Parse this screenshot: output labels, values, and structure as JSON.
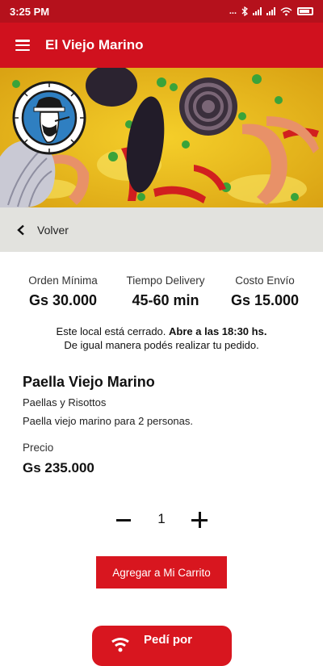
{
  "status_bar": {
    "time": "3:25 PM",
    "dots": "..."
  },
  "app_bar": {
    "title": "El Viejo Marino",
    "menu_icon": "hamburger-menu-icon"
  },
  "hero": {
    "logo_icon": "sailor-logo"
  },
  "back": {
    "label": "Volver",
    "icon": "chevron-left-icon"
  },
  "stats": [
    {
      "label": "Orden Mínima",
      "value": "Gs 30.000"
    },
    {
      "label": "Tiempo Delivery",
      "value": "45-60 min"
    },
    {
      "label": "Costo Envío",
      "value": "Gs 15.000"
    }
  ],
  "notice": {
    "closed_text": "Este local está cerrado.",
    "opens_text": "Abre a las 18:30 hs.",
    "order_anyway": "De igual manera podés realizar tu pedido."
  },
  "product": {
    "name": "Paella Viejo Marino",
    "category": "Paellas y Risottos",
    "description": "Paella viejo marino para 2 personas.",
    "price_label": "Precio",
    "price": "Gs 235.000"
  },
  "quantity": {
    "value": "1",
    "minus_icon": "minus-icon",
    "plus_icon": "plus-icon"
  },
  "cart_button": {
    "label": "Agregar a Mi Carrito"
  },
  "order_button": {
    "label": "Pedí por",
    "icon": "wifi-signal-icon"
  },
  "colors": {
    "status_bar": "#b5111c",
    "app_bar": "#d0111e",
    "accent": "#d8161f",
    "back_bar": "#e2e2de"
  }
}
